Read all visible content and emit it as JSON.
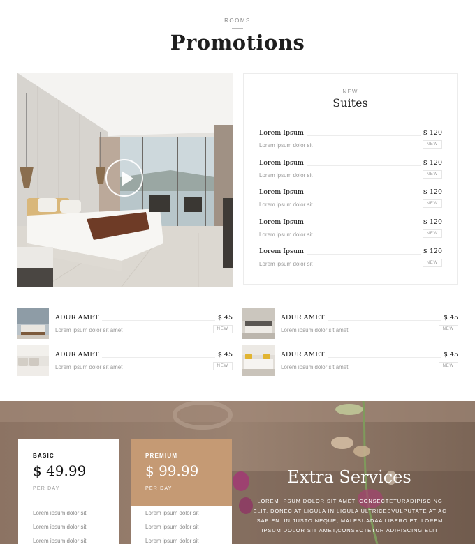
{
  "header": {
    "eyebrow": "ROOMS",
    "title": "Promotions"
  },
  "hero": {
    "play_icon": "play-icon"
  },
  "suites": {
    "eyebrow": "NEW",
    "title": "Suites",
    "items": [
      {
        "name": "Lorem Ipsum",
        "price": "$ 120",
        "description": "Lorem ipsum dolor sit",
        "tag": "NEW"
      },
      {
        "name": "Lorem Ipsum",
        "price": "$ 120",
        "description": "Lorem ipsum dolor sit",
        "tag": "NEW"
      },
      {
        "name": "Lorem Ipsum",
        "price": "$ 120",
        "description": "Lorem ipsum dolor sit",
        "tag": "NEW"
      },
      {
        "name": "Lorem Ipsum",
        "price": "$ 120",
        "description": "Lorem ipsum dolor sit",
        "tag": "NEW"
      },
      {
        "name": "Lorem Ipsum",
        "price": "$ 120",
        "description": "Lorem ipsum dolor sit",
        "tag": "NEW"
      }
    ]
  },
  "rooms": [
    {
      "name": "ADUR AMET",
      "price": "$ 45",
      "description": "Lorem ipsum dolor sit amet",
      "tag": "NEW"
    },
    {
      "name": "ADUR AMET",
      "price": "$ 45",
      "description": "Lorem ipsum dolor sit amet",
      "tag": "NEW"
    },
    {
      "name": "ADUR AMET",
      "price": "$ 45",
      "description": "Lorem ipsum dolor sit amet",
      "tag": "NEW"
    },
    {
      "name": "ADUR AMET",
      "price": "$ 45",
      "description": "Lorem ipsum dolor sit amet",
      "tag": "NEW"
    }
  ],
  "pricing": {
    "basic": {
      "name": "BASIC",
      "price": "$ 49.99",
      "period": "PER DAY",
      "features": [
        "Lorem ipsum dolor sit",
        "Lorem ipsum dolor sit",
        "Lorem ipsum dolor sit"
      ]
    },
    "premium": {
      "name": "PREMIUM",
      "price": "$ 99.99",
      "period": "PER DAY",
      "features": [
        "Lorem ipsum dolor sit",
        "Lorem ipsum dolor sit",
        "Lorem ipsum dolor sit"
      ]
    }
  },
  "extra_services": {
    "title": "Extra Services",
    "text": "Lorem ipsum dolor sit amet, consecteturadipiscing elit. Donec at ligula in ligula ultricesvulputate at ac sapien. In justo neque, malesuadaa libero et, lorem ipsum dolor sit amet,consectetur adipiscing elit"
  },
  "colors": {
    "accent": "#c59a74",
    "text_dark": "#1e1e1e",
    "text_muted": "#999999",
    "border": "#ececec"
  }
}
